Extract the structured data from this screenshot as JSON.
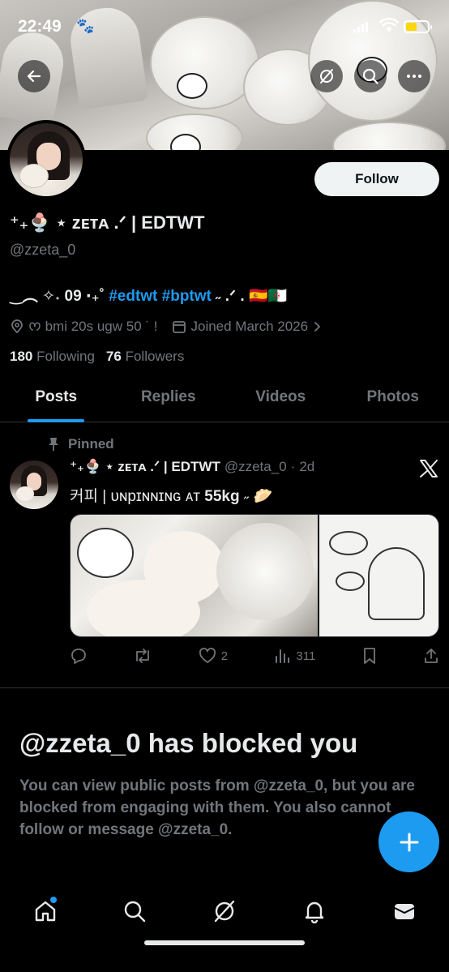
{
  "status_bar": {
    "time": "22:49",
    "paw_glyph": "🐾",
    "battery_color": "#ffd60a"
  },
  "banner": {
    "back_icon": "arrow-left-icon",
    "grok_icon": "grok-icon",
    "search_icon": "search-icon",
    "more_icon": "more-horizontal-icon"
  },
  "profile": {
    "follow_label": "Follow",
    "display_name": "⁺₊🍨 ⋆ ᴢᴇᴛᴀ .ᐟ | EDTWT",
    "handle": "@zzeta_0",
    "bio_prefix": "‿︵ ✧˖ 09 ‧₊˚ ",
    "bio_hashtags": "#edtwt #bptwt",
    "bio_suffix": " ˶ .ᐟ . 🇪🇸🇩🇿",
    "location": "ᰔ bmi 20s  ugw 50 ˙ !",
    "joined": "Joined March 2026",
    "following_count": "180",
    "following_label": "Following",
    "followers_count": "76",
    "followers_label": "Followers"
  },
  "tabs": [
    {
      "label": "Posts",
      "active": true
    },
    {
      "label": "Replies",
      "active": false
    },
    {
      "label": "Videos",
      "active": false
    },
    {
      "label": "Photos",
      "active": false
    }
  ],
  "post": {
    "pinned_label": "Pinned",
    "author_name": "⁺₊🍨 ⋆ ᴢᴇᴛᴀ .ᐟ | EDTWT",
    "author_handle": "@zzeta_0",
    "separator": "·",
    "time_ago": "2d",
    "text_prefix": "커피 |  ᴜɴpɪɴɴɪɴɢ ᴀᴛ ",
    "text_bold": "55kg",
    "text_suffix": " ˶  🥟",
    "likes": "2",
    "views": "311"
  },
  "blocked": {
    "title": "@zzeta_0 has blocked you",
    "body": "You can view public posts from @zzeta_0, but you are blocked from engaging with them. You also cannot follow or message @zzeta_0."
  },
  "colors": {
    "accent": "#1d9bf0",
    "background": "#000000",
    "text_primary": "#e7e9ea",
    "text_secondary": "#71767b"
  }
}
